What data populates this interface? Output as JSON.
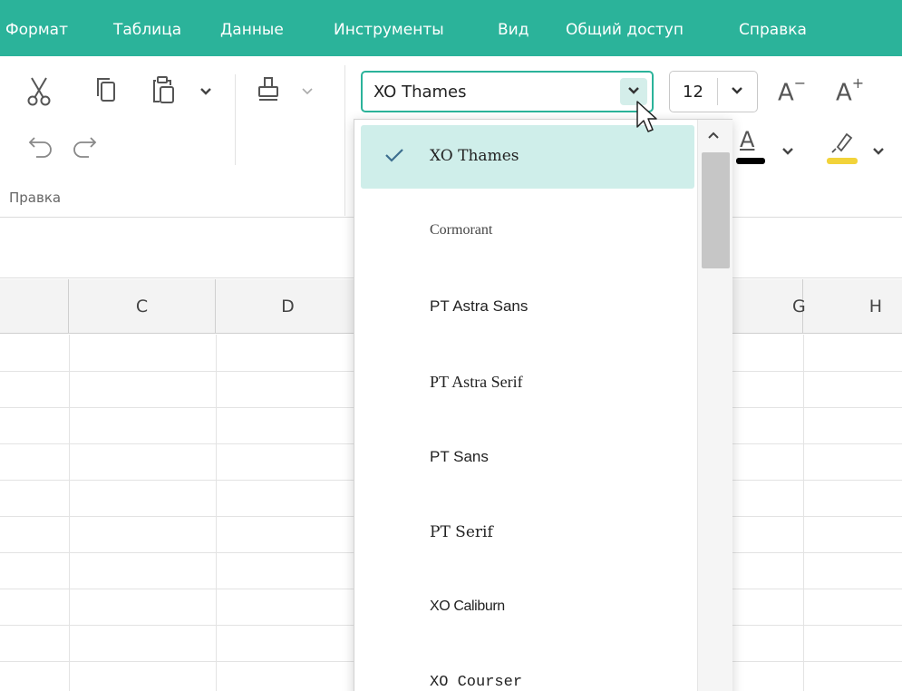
{
  "menu": {
    "items": [
      "Формат",
      "Таблица",
      "Данные",
      "Инструменты",
      "Вид",
      "Общий доступ",
      "Справка"
    ]
  },
  "toolbar": {
    "group_label": "Правка",
    "font_name": "XO Thames",
    "font_size": "12",
    "decrease_font": "A",
    "increase_font": "A",
    "font_color_letter": "A"
  },
  "colors": {
    "accent": "#2bb39a",
    "selected_bg": "#cfeeea",
    "font_color_swatch": "#000000",
    "highlight_swatch": "#f2d33a"
  },
  "columns": [
    "C",
    "D",
    "G",
    "H"
  ],
  "dropdown": {
    "options": [
      {
        "label": "XO Thames",
        "selected": true
      },
      {
        "label": "Cormorant",
        "selected": false
      },
      {
        "label": "PT Astra Sans",
        "selected": false
      },
      {
        "label": "PT Astra Serif",
        "selected": false
      },
      {
        "label": "PT Sans",
        "selected": false
      },
      {
        "label": "PT Serif",
        "selected": false
      },
      {
        "label": "XO Caliburn",
        "selected": false
      },
      {
        "label": "XO Courser",
        "selected": false
      }
    ]
  },
  "icons": [
    "cut-icon",
    "copy-icon",
    "paste-icon",
    "format-painter-icon",
    "undo-icon",
    "redo-icon",
    "chevron-down-icon",
    "check-icon",
    "highlighter-icon",
    "cursor-icon"
  ]
}
